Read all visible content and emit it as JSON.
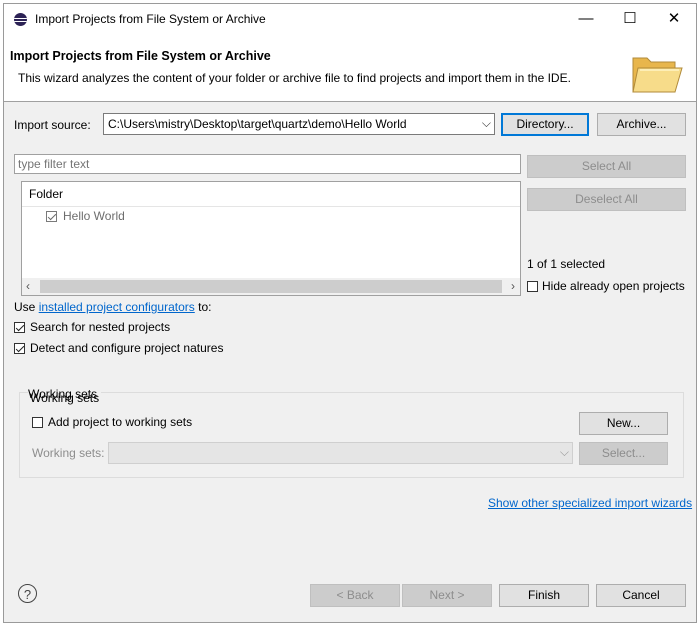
{
  "window": {
    "title": "Import Projects from File System or Archive",
    "controls": {
      "minimize": "—",
      "maximize": "☐",
      "close": "✕"
    }
  },
  "header": {
    "title": "Import Projects from File System or Archive",
    "description": "This wizard analyzes the content of your folder or archive file to find projects and import them in the IDE.",
    "icon": "folder-icon"
  },
  "source": {
    "label": "Import source:",
    "value": "C:\\Users\\mistry\\Desktop\\target\\quartz\\demo\\Hello World",
    "directory_button": "Directory...",
    "archive_button": "Archive..."
  },
  "filter": {
    "placeholder": "type filter text"
  },
  "tree": {
    "column": "Folder",
    "rows": [
      {
        "label": "Hello World",
        "checked": true
      }
    ]
  },
  "selection": {
    "select_all": "Select All",
    "deselect_all": "Deselect All",
    "count": "1 of 1 selected",
    "hide_open": "Hide already open projects"
  },
  "configurators": {
    "prefix": "Use ",
    "link": "installed project configurators",
    "suffix": " to:"
  },
  "options": {
    "search_nested": "Search for nested projects",
    "detect_natures": "Detect and configure project natures"
  },
  "working_sets": {
    "group_title": "Working sets",
    "add_label": "Add project to working sets",
    "new_button": "New...",
    "sets_label": "Working sets:",
    "select_button": "Select..."
  },
  "more_link": "Show other specialized import wizards",
  "footer": {
    "help": "?",
    "back": "< Back",
    "next": "Next >",
    "finish": "Finish",
    "cancel": "Cancel"
  },
  "colors": {
    "link": "#0066cc",
    "default_button_border": "#0078d7"
  }
}
